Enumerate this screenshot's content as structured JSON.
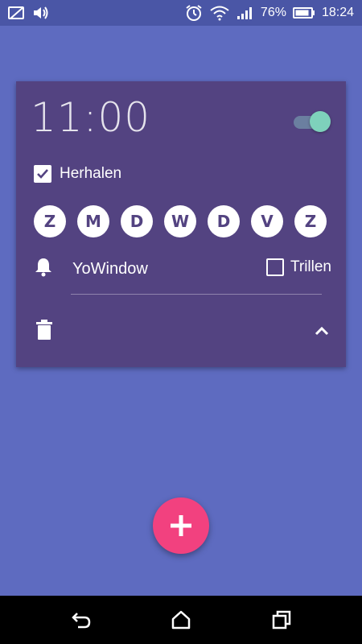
{
  "status_bar": {
    "battery_percent": "76%",
    "time": "18:24",
    "icons": [
      "no-sim-icon",
      "volume-icon",
      "alarm-clock-icon",
      "wifi-icon",
      "signal-icon",
      "battery-icon"
    ]
  },
  "alarm": {
    "time": "11:00",
    "enabled": true,
    "repeat_label": "Herhalen",
    "repeat_checked": true,
    "days": [
      "Z",
      "M",
      "D",
      "W",
      "D",
      "V",
      "Z"
    ],
    "sound_name": "YoWindow",
    "vibrate_label": "Trillen",
    "vibrate_checked": false
  },
  "colors": {
    "background": "#5E6BC0",
    "status_bar": "#4A56A6",
    "card": "#534381",
    "toggle_thumb": "#7ED1BB",
    "fab": "#F2417F",
    "nav_bar": "#000000"
  },
  "fab": {
    "icon": "plus-icon"
  },
  "nav": {
    "icons": [
      "back-icon",
      "home-icon",
      "recents-icon"
    ]
  }
}
